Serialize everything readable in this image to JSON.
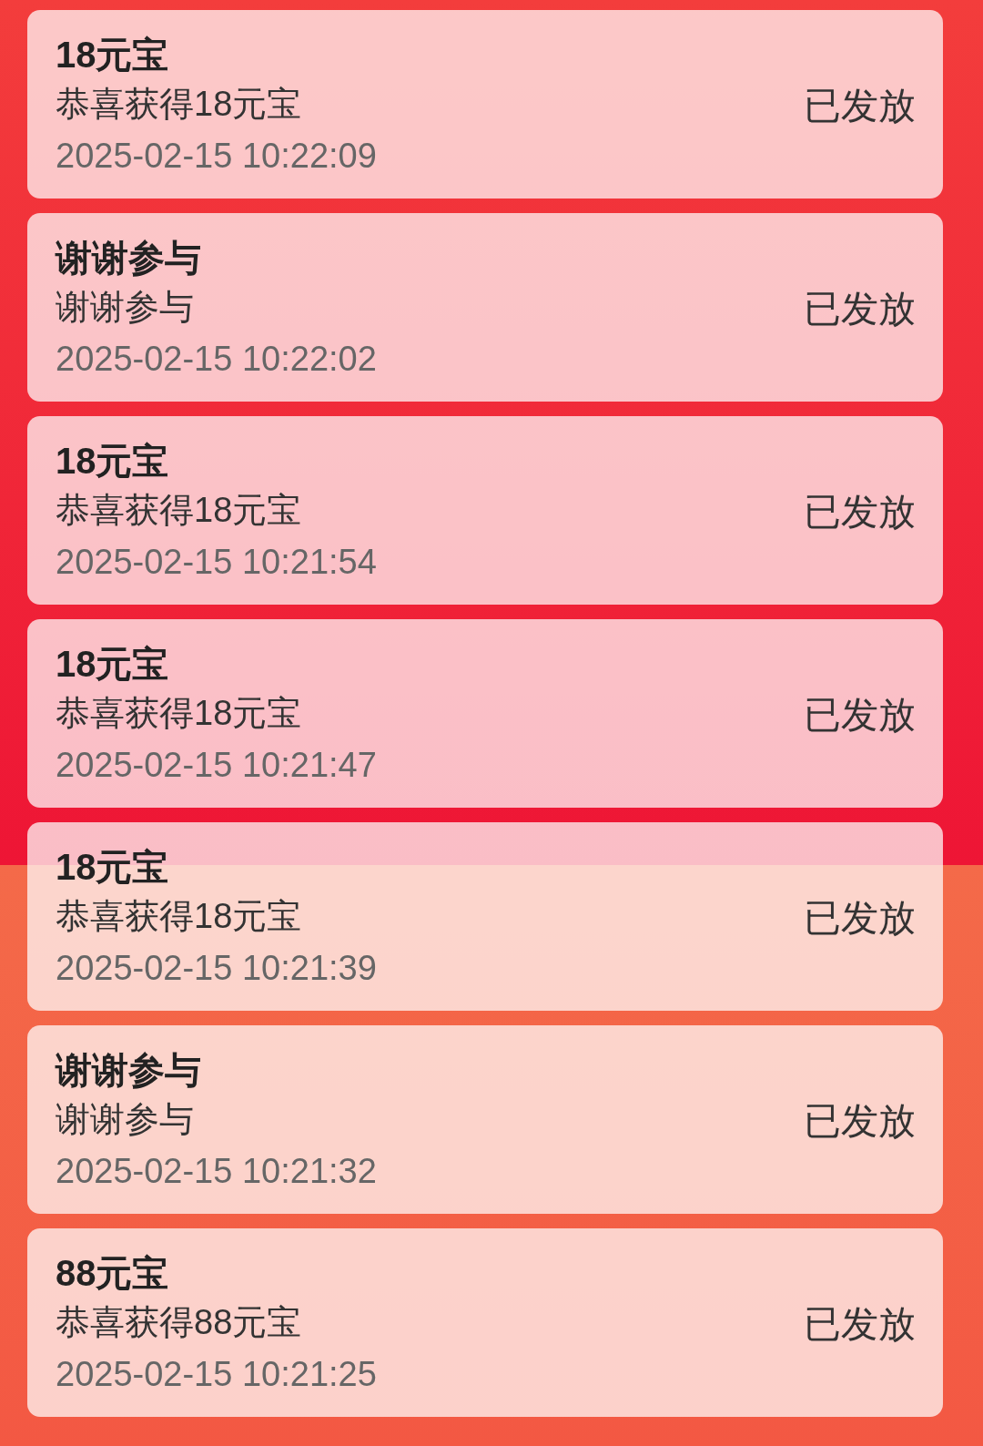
{
  "records": [
    {
      "title": "18元宝",
      "description": "恭喜获得18元宝",
      "time": "2025-02-15 10:22:09",
      "status": "已发放"
    },
    {
      "title": "谢谢参与",
      "description": "谢谢参与",
      "time": "2025-02-15 10:22:02",
      "status": "已发放"
    },
    {
      "title": "18元宝",
      "description": "恭喜获得18元宝",
      "time": "2025-02-15 10:21:54",
      "status": "已发放"
    },
    {
      "title": "18元宝",
      "description": "恭喜获得18元宝",
      "time": "2025-02-15 10:21:47",
      "status": "已发放"
    },
    {
      "title": "18元宝",
      "description": "恭喜获得18元宝",
      "time": "2025-02-15 10:21:39",
      "status": "已发放"
    },
    {
      "title": "谢谢参与",
      "description": "谢谢参与",
      "time": "2025-02-15 10:21:32",
      "status": "已发放"
    },
    {
      "title": "88元宝",
      "description": "恭喜获得88元宝",
      "time": "2025-02-15 10:21:25",
      "status": "已发放"
    }
  ]
}
